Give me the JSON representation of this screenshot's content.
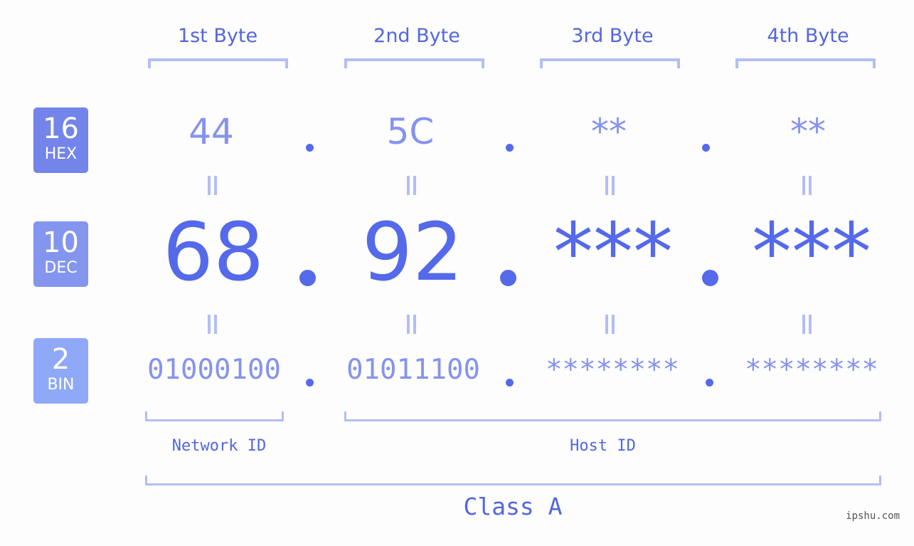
{
  "colors": {
    "accent": "#5569eb",
    "label_text": "#5466e0",
    "muted_value": "#8593ee",
    "bracket": "#b3bdf6",
    "badge_hex": "#7384ea",
    "badge_dec": "#8495f0",
    "badge_bin": "#8fa8f8",
    "background": "#fcfdfc"
  },
  "badges": [
    {
      "base": "16",
      "name": "HEX"
    },
    {
      "base": "10",
      "name": "DEC"
    },
    {
      "base": "2",
      "name": "BIN"
    }
  ],
  "byte_headers": [
    "1st Byte",
    "2nd Byte",
    "3rd Byte",
    "4th Byte"
  ],
  "hex": [
    "44",
    "5C",
    "**",
    "**"
  ],
  "dec": [
    "68",
    "92",
    "***",
    "***"
  ],
  "bin": [
    "01000100",
    "01011100",
    "********",
    "********"
  ],
  "separator": ".",
  "segments": {
    "network_id": "Network ID",
    "host_id": "Host ID"
  },
  "ip_class": "Class A",
  "watermark": "ipshu.com"
}
